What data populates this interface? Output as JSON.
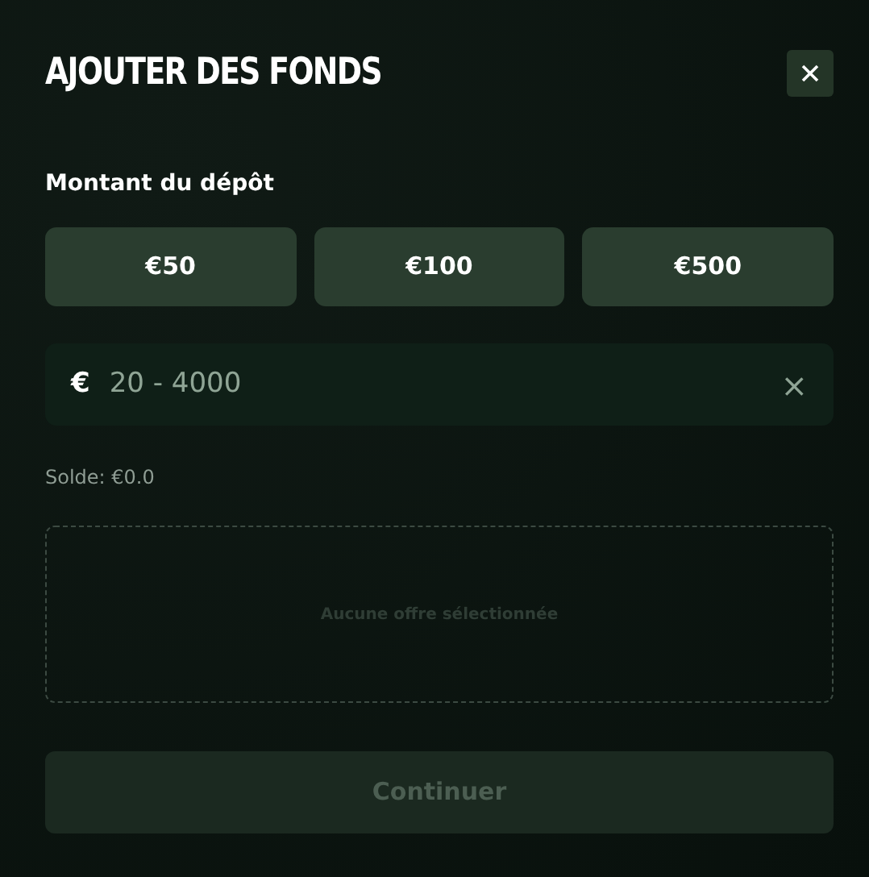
{
  "title": "AJOUTER DES FONDS",
  "amount_label": "Montant du dépôt",
  "presets": [
    {
      "label": "€50",
      "selected": false
    },
    {
      "label": "€100",
      "selected": false
    },
    {
      "label": "€500",
      "selected": false
    }
  ],
  "amount_field": {
    "currency": "€",
    "placeholder": "20 - 4000",
    "clear": "×"
  },
  "balance": "Solde: €0.0",
  "offer_box": {
    "text": "Aucune offre sélectionnée"
  },
  "continue_button": {
    "label": "Continuer",
    "disabled": true
  }
}
